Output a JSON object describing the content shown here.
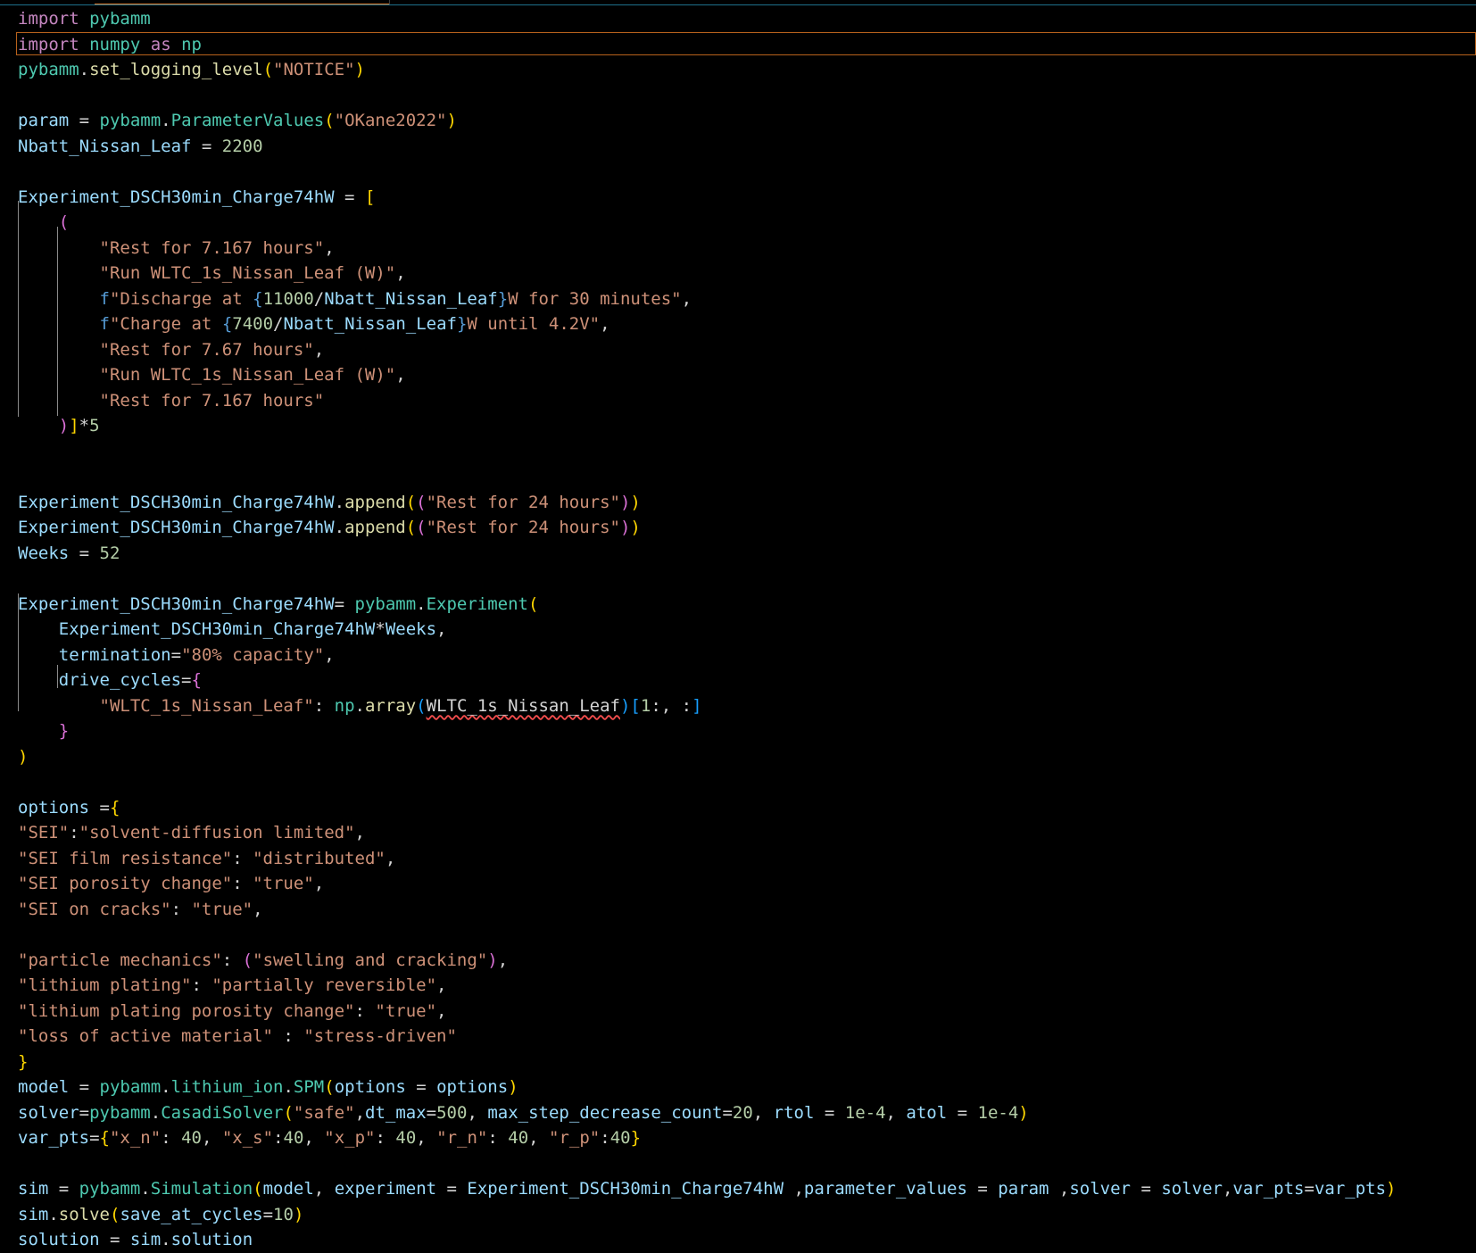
{
  "editor": {
    "tab_active_label": "",
    "lines": [
      {
        "tokens": [
          [
            "kw",
            "import"
          ],
          [
            "op",
            " "
          ],
          [
            "mod",
            "pybamm"
          ]
        ]
      },
      {
        "current": true,
        "tokens": [
          [
            "kw",
            "import"
          ],
          [
            "op",
            " "
          ],
          [
            "mod",
            "numpy"
          ],
          [
            "op",
            " "
          ],
          [
            "kw",
            "as"
          ],
          [
            "op",
            " "
          ],
          [
            "mod",
            "np"
          ]
        ]
      },
      {
        "tokens": [
          [
            "mod",
            "pybamm"
          ],
          [
            "op",
            "."
          ],
          [
            "fn",
            "set_logging_level"
          ],
          [
            "b1",
            "("
          ],
          [
            "str",
            "\"NOTICE\""
          ],
          [
            "b1",
            ")"
          ]
        ]
      },
      {
        "tokens": []
      },
      {
        "tokens": [
          [
            "var",
            "param"
          ],
          [
            "op",
            " = "
          ],
          [
            "mod",
            "pybamm"
          ],
          [
            "op",
            "."
          ],
          [
            "mod",
            "ParameterValues"
          ],
          [
            "b1",
            "("
          ],
          [
            "str",
            "\"OKane2022\""
          ],
          [
            "b1",
            ")"
          ]
        ]
      },
      {
        "tokens": [
          [
            "var",
            "Nbatt_Nissan_Leaf"
          ],
          [
            "op",
            " = "
          ],
          [
            "num",
            "2200"
          ]
        ]
      },
      {
        "tokens": []
      },
      {
        "tokens": [
          [
            "var",
            "Experiment_DSCH30min_Charge74hW"
          ],
          [
            "op",
            " = "
          ],
          [
            "b1",
            "["
          ]
        ]
      },
      {
        "tokens": [
          [
            "op",
            "    "
          ],
          [
            "b2",
            "("
          ]
        ]
      },
      {
        "tokens": [
          [
            "op",
            "        "
          ],
          [
            "str",
            "\"Rest for 7.167 hours\""
          ],
          [
            "op",
            ","
          ]
        ]
      },
      {
        "tokens": [
          [
            "op",
            "        "
          ],
          [
            "str",
            "\"Run WLTC_1s_Nissan_Leaf (W)\""
          ],
          [
            "op",
            ","
          ]
        ]
      },
      {
        "tokens": [
          [
            "op",
            "        "
          ],
          [
            "fpre",
            "f"
          ],
          [
            "str",
            "\"Discharge at "
          ],
          [
            "fpre",
            "{"
          ],
          [
            "num",
            "11000"
          ],
          [
            "op",
            "/"
          ],
          [
            "var",
            "Nbatt_Nissan_Leaf"
          ],
          [
            "fpre",
            "}"
          ],
          [
            "str",
            "W for 30 minutes\""
          ],
          [
            "op",
            ","
          ]
        ]
      },
      {
        "tokens": [
          [
            "op",
            "        "
          ],
          [
            "fpre",
            "f"
          ],
          [
            "str",
            "\"Charge at "
          ],
          [
            "fpre",
            "{"
          ],
          [
            "num",
            "7400"
          ],
          [
            "op",
            "/"
          ],
          [
            "var",
            "Nbatt_Nissan_Leaf"
          ],
          [
            "fpre",
            "}"
          ],
          [
            "str",
            "W until 4.2V\""
          ],
          [
            "op",
            ","
          ]
        ]
      },
      {
        "tokens": [
          [
            "op",
            "        "
          ],
          [
            "str",
            "\"Rest for 7.67 hours\""
          ],
          [
            "op",
            ","
          ]
        ]
      },
      {
        "tokens": [
          [
            "op",
            "        "
          ],
          [
            "str",
            "\"Run WLTC_1s_Nissan_Leaf (W)\""
          ],
          [
            "op",
            ","
          ]
        ]
      },
      {
        "tokens": [
          [
            "op",
            "        "
          ],
          [
            "str",
            "\"Rest for 7.167 hours\""
          ]
        ]
      },
      {
        "tokens": [
          [
            "op",
            "    "
          ],
          [
            "b2",
            ")"
          ],
          [
            "b1",
            "]"
          ],
          [
            "op",
            "*"
          ],
          [
            "num",
            "5"
          ]
        ]
      },
      {
        "tokens": []
      },
      {
        "tokens": []
      },
      {
        "tokens": [
          [
            "var",
            "Experiment_DSCH30min_Charge74hW"
          ],
          [
            "op",
            "."
          ],
          [
            "fn",
            "append"
          ],
          [
            "b1",
            "("
          ],
          [
            "b2",
            "("
          ],
          [
            "str",
            "\"Rest for 24 hours\""
          ],
          [
            "b2",
            ")"
          ],
          [
            "b1",
            ")"
          ]
        ]
      },
      {
        "tokens": [
          [
            "var",
            "Experiment_DSCH30min_Charge74hW"
          ],
          [
            "op",
            "."
          ],
          [
            "fn",
            "append"
          ],
          [
            "b1",
            "("
          ],
          [
            "b2",
            "("
          ],
          [
            "str",
            "\"Rest for 24 hours\""
          ],
          [
            "b2",
            ")"
          ],
          [
            "b1",
            ")"
          ]
        ]
      },
      {
        "tokens": [
          [
            "var",
            "Weeks"
          ],
          [
            "op",
            " = "
          ],
          [
            "num",
            "52"
          ]
        ]
      },
      {
        "tokens": []
      },
      {
        "tokens": [
          [
            "var",
            "Experiment_DSCH30min_Charge74hW"
          ],
          [
            "op",
            "= "
          ],
          [
            "mod",
            "pybamm"
          ],
          [
            "op",
            "."
          ],
          [
            "mod",
            "Experiment"
          ],
          [
            "b1",
            "("
          ]
        ]
      },
      {
        "tokens": [
          [
            "op",
            "    "
          ],
          [
            "var",
            "Experiment_DSCH30min_Charge74hW"
          ],
          [
            "op",
            "*"
          ],
          [
            "var",
            "Weeks"
          ],
          [
            "op",
            ","
          ]
        ]
      },
      {
        "tokens": [
          [
            "op",
            "    "
          ],
          [
            "var",
            "termination"
          ],
          [
            "op",
            "="
          ],
          [
            "str",
            "\"80% capacity\""
          ],
          [
            "op",
            ","
          ]
        ]
      },
      {
        "tokens": [
          [
            "op",
            "    "
          ],
          [
            "var",
            "drive_cycles"
          ],
          [
            "op",
            "="
          ],
          [
            "b2",
            "{"
          ]
        ]
      },
      {
        "tokens": [
          [
            "op",
            "        "
          ],
          [
            "str",
            "\"WLTC_1s_Nissan_Leaf\""
          ],
          [
            "op",
            ": "
          ],
          [
            "mod",
            "np"
          ],
          [
            "op",
            "."
          ],
          [
            "fn",
            "array"
          ],
          [
            "b3",
            "("
          ],
          [
            "squig",
            "WLTC_1s_Nissan_Leaf"
          ],
          [
            "b3",
            ")"
          ],
          [
            "b3",
            "["
          ],
          [
            "num",
            "1"
          ],
          [
            "op",
            ":, :"
          ],
          [
            "b3",
            "]"
          ]
        ]
      },
      {
        "tokens": [
          [
            "op",
            "    "
          ],
          [
            "b2",
            "}"
          ]
        ]
      },
      {
        "tokens": [
          [
            "b1",
            ")"
          ]
        ]
      },
      {
        "tokens": []
      },
      {
        "tokens": [
          [
            "var",
            "options"
          ],
          [
            "op",
            " ="
          ],
          [
            "b1",
            "{"
          ]
        ]
      },
      {
        "tokens": [
          [
            "str",
            "\"SEI\""
          ],
          [
            "op",
            ":"
          ],
          [
            "str",
            "\"solvent-diffusion limited\""
          ],
          [
            "op",
            ","
          ]
        ]
      },
      {
        "tokens": [
          [
            "str",
            "\"SEI film resistance\""
          ],
          [
            "op",
            ": "
          ],
          [
            "str",
            "\"distributed\""
          ],
          [
            "op",
            ","
          ]
        ]
      },
      {
        "tokens": [
          [
            "str",
            "\"SEI porosity change\""
          ],
          [
            "op",
            ": "
          ],
          [
            "str",
            "\"true\""
          ],
          [
            "op",
            ","
          ]
        ]
      },
      {
        "tokens": [
          [
            "str",
            "\"SEI on cracks\""
          ],
          [
            "op",
            ": "
          ],
          [
            "str",
            "\"true\""
          ],
          [
            "op",
            ","
          ]
        ]
      },
      {
        "tokens": []
      },
      {
        "tokens": [
          [
            "str",
            "\"particle mechanics\""
          ],
          [
            "op",
            ": "
          ],
          [
            "b2",
            "("
          ],
          [
            "str",
            "\"swelling and cracking\""
          ],
          [
            "b2",
            ")"
          ],
          [
            "op",
            ","
          ]
        ]
      },
      {
        "tokens": [
          [
            "str",
            "\"lithium plating\""
          ],
          [
            "op",
            ": "
          ],
          [
            "str",
            "\"partially reversible\""
          ],
          [
            "op",
            ","
          ]
        ]
      },
      {
        "tokens": [
          [
            "str",
            "\"lithium plating porosity change\""
          ],
          [
            "op",
            ": "
          ],
          [
            "str",
            "\"true\""
          ],
          [
            "op",
            ","
          ]
        ]
      },
      {
        "tokens": [
          [
            "str",
            "\"loss of active material\""
          ],
          [
            "op",
            " : "
          ],
          [
            "str",
            "\"stress-driven\""
          ]
        ]
      },
      {
        "tokens": [
          [
            "b1",
            "}"
          ]
        ]
      },
      {
        "tokens": [
          [
            "var",
            "model"
          ],
          [
            "op",
            " = "
          ],
          [
            "mod",
            "pybamm"
          ],
          [
            "op",
            "."
          ],
          [
            "mod",
            "lithium_ion"
          ],
          [
            "op",
            "."
          ],
          [
            "mod",
            "SPM"
          ],
          [
            "b1",
            "("
          ],
          [
            "var",
            "options"
          ],
          [
            "op",
            " = "
          ],
          [
            "var",
            "options"
          ],
          [
            "b1",
            ")"
          ]
        ]
      },
      {
        "tokens": [
          [
            "var",
            "solver"
          ],
          [
            "op",
            "="
          ],
          [
            "mod",
            "pybamm"
          ],
          [
            "op",
            "."
          ],
          [
            "mod",
            "CasadiSolver"
          ],
          [
            "b1",
            "("
          ],
          [
            "str",
            "\"safe\""
          ],
          [
            "op",
            ","
          ],
          [
            "var",
            "dt_max"
          ],
          [
            "op",
            "="
          ],
          [
            "num",
            "500"
          ],
          [
            "op",
            ", "
          ],
          [
            "var",
            "max_step_decrease_count"
          ],
          [
            "op",
            "="
          ],
          [
            "num",
            "20"
          ],
          [
            "op",
            ", "
          ],
          [
            "var",
            "rtol"
          ],
          [
            "op",
            " = "
          ],
          [
            "num",
            "1e-4"
          ],
          [
            "op",
            ", "
          ],
          [
            "var",
            "atol"
          ],
          [
            "op",
            " = "
          ],
          [
            "num",
            "1e-4"
          ],
          [
            "b1",
            ")"
          ]
        ]
      },
      {
        "tokens": [
          [
            "var",
            "var_pts"
          ],
          [
            "op",
            "="
          ],
          [
            "b1",
            "{"
          ],
          [
            "str",
            "\"x_n\""
          ],
          [
            "op",
            ": "
          ],
          [
            "num",
            "40"
          ],
          [
            "op",
            ", "
          ],
          [
            "str",
            "\"x_s\""
          ],
          [
            "op",
            ":"
          ],
          [
            "num",
            "40"
          ],
          [
            "op",
            ", "
          ],
          [
            "str",
            "\"x_p\""
          ],
          [
            "op",
            ": "
          ],
          [
            "num",
            "40"
          ],
          [
            "op",
            ", "
          ],
          [
            "str",
            "\"r_n\""
          ],
          [
            "op",
            ": "
          ],
          [
            "num",
            "40"
          ],
          [
            "op",
            ", "
          ],
          [
            "str",
            "\"r_p\""
          ],
          [
            "op",
            ":"
          ],
          [
            "num",
            "40"
          ],
          [
            "b1",
            "}"
          ]
        ]
      },
      {
        "tokens": []
      },
      {
        "tokens": [
          [
            "var",
            "sim"
          ],
          [
            "op",
            " = "
          ],
          [
            "mod",
            "pybamm"
          ],
          [
            "op",
            "."
          ],
          [
            "mod",
            "Simulation"
          ],
          [
            "b1",
            "("
          ],
          [
            "var",
            "model"
          ],
          [
            "op",
            ", "
          ],
          [
            "var",
            "experiment"
          ],
          [
            "op",
            " = "
          ],
          [
            "var",
            "Experiment_DSCH30min_Charge74hW"
          ],
          [
            "op",
            " ,"
          ],
          [
            "var",
            "parameter_values"
          ],
          [
            "op",
            " = "
          ],
          [
            "var",
            "param"
          ],
          [
            "op",
            " ,"
          ],
          [
            "var",
            "solver"
          ],
          [
            "op",
            " = "
          ],
          [
            "var",
            "solver"
          ],
          [
            "op",
            ","
          ],
          [
            "var",
            "var_pts"
          ],
          [
            "op",
            "="
          ],
          [
            "var",
            "var_pts"
          ],
          [
            "b1",
            ")"
          ]
        ]
      },
      {
        "tokens": [
          [
            "var",
            "sim"
          ],
          [
            "op",
            "."
          ],
          [
            "fn",
            "solve"
          ],
          [
            "b1",
            "("
          ],
          [
            "var",
            "save_at_cycles"
          ],
          [
            "op",
            "="
          ],
          [
            "num",
            "10"
          ],
          [
            "b1",
            ")"
          ]
        ]
      },
      {
        "tokens": [
          [
            "var",
            "solution"
          ],
          [
            "op",
            " = "
          ],
          [
            "var",
            "sim"
          ],
          [
            "op",
            "."
          ],
          [
            "var",
            "solution"
          ]
        ]
      }
    ]
  }
}
